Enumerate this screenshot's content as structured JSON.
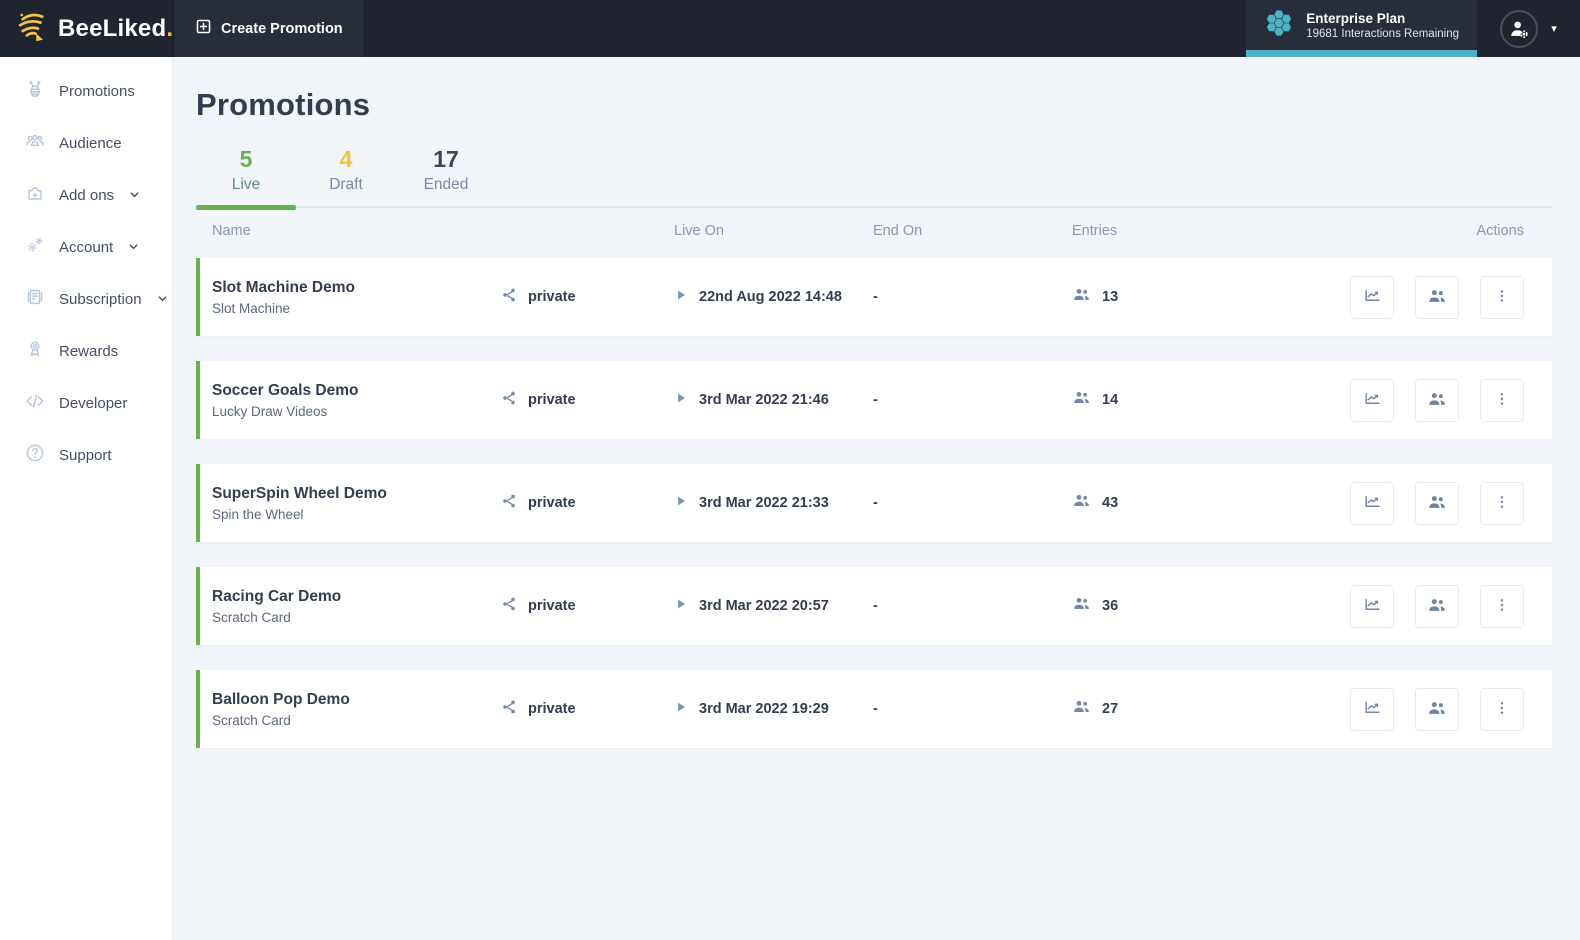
{
  "brand": {
    "name": "BeeLiked",
    "dot": "."
  },
  "topbar": {
    "create_label": "Create Promotion",
    "plan": {
      "name": "Enterprise Plan",
      "remaining": "19681 Interactions Remaining"
    },
    "accent_color": "#4db3c4"
  },
  "sidebar": {
    "items": [
      {
        "label": "Promotions",
        "icon": "bee-icon",
        "chevron": false
      },
      {
        "label": "Audience",
        "icon": "audience-icon",
        "chevron": false
      },
      {
        "label": "Add ons",
        "icon": "puzzle-icon",
        "chevron": true
      },
      {
        "label": "Account",
        "icon": "gears-icon",
        "chevron": true
      },
      {
        "label": "Subscription",
        "icon": "subscription-icon",
        "chevron": true
      },
      {
        "label": "Rewards",
        "icon": "medal-icon",
        "chevron": false
      },
      {
        "label": "Developer",
        "icon": "code-icon",
        "chevron": false
      },
      {
        "label": "Support",
        "icon": "question-icon",
        "chevron": false
      }
    ]
  },
  "page": {
    "title": "Promotions"
  },
  "tabs": [
    {
      "count": "5",
      "label": "Live",
      "active": true,
      "count_color": "#6cb151"
    },
    {
      "count": "4",
      "label": "Draft",
      "active": false,
      "count_color": "#f2c230"
    },
    {
      "count": "17",
      "label": "Ended",
      "active": false,
      "count_color": "#3b455c"
    }
  ],
  "table": {
    "headers": {
      "name": "Name",
      "live_on": "Live On",
      "end_on": "End On",
      "entries": "Entries",
      "actions": "Actions"
    },
    "row_accent_color": "#6cb151",
    "action_icons": [
      "analytics-icon",
      "entries-users-icon",
      "kebab-menu-icon"
    ],
    "rows": [
      {
        "name": "Slot Machine Demo",
        "subtitle": "Slot Machine",
        "visibility": "private",
        "live_on": "22nd Aug 2022 14:48",
        "end_on": "-",
        "entries": "13"
      },
      {
        "name": "Soccer Goals Demo",
        "subtitle": "Lucky Draw Videos",
        "visibility": "private",
        "live_on": "3rd Mar 2022 21:46",
        "end_on": "-",
        "entries": "14"
      },
      {
        "name": "SuperSpin Wheel Demo",
        "subtitle": "Spin the Wheel",
        "visibility": "private",
        "live_on": "3rd Mar 2022 21:33",
        "end_on": "-",
        "entries": "43"
      },
      {
        "name": "Racing Car Demo",
        "subtitle": "Scratch Card",
        "visibility": "private",
        "live_on": "3rd Mar 2022 20:57",
        "end_on": "-",
        "entries": "36"
      },
      {
        "name": "Balloon Pop Demo",
        "subtitle": "Scratch Card",
        "visibility": "private",
        "live_on": "3rd Mar 2022 19:29",
        "end_on": "-",
        "entries": "27"
      }
    ]
  }
}
